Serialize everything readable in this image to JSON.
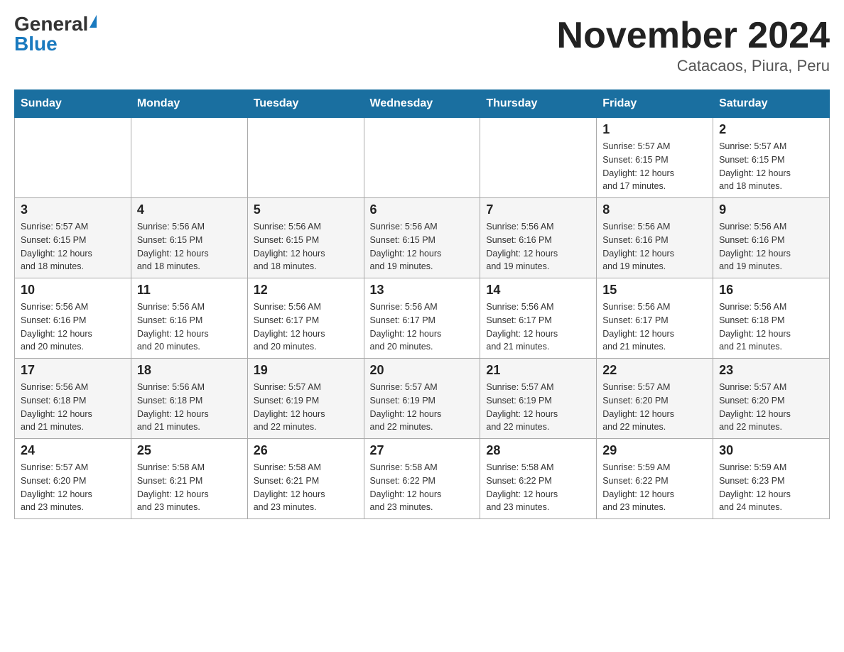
{
  "header": {
    "logo_general": "General",
    "logo_blue": "Blue",
    "title": "November 2024",
    "subtitle": "Catacaos, Piura, Peru"
  },
  "weekdays": [
    "Sunday",
    "Monday",
    "Tuesday",
    "Wednesday",
    "Thursday",
    "Friday",
    "Saturday"
  ],
  "weeks": [
    [
      {
        "day": "",
        "info": ""
      },
      {
        "day": "",
        "info": ""
      },
      {
        "day": "",
        "info": ""
      },
      {
        "day": "",
        "info": ""
      },
      {
        "day": "",
        "info": ""
      },
      {
        "day": "1",
        "info": "Sunrise: 5:57 AM\nSunset: 6:15 PM\nDaylight: 12 hours\nand 17 minutes."
      },
      {
        "day": "2",
        "info": "Sunrise: 5:57 AM\nSunset: 6:15 PM\nDaylight: 12 hours\nand 18 minutes."
      }
    ],
    [
      {
        "day": "3",
        "info": "Sunrise: 5:57 AM\nSunset: 6:15 PM\nDaylight: 12 hours\nand 18 minutes."
      },
      {
        "day": "4",
        "info": "Sunrise: 5:56 AM\nSunset: 6:15 PM\nDaylight: 12 hours\nand 18 minutes."
      },
      {
        "day": "5",
        "info": "Sunrise: 5:56 AM\nSunset: 6:15 PM\nDaylight: 12 hours\nand 18 minutes."
      },
      {
        "day": "6",
        "info": "Sunrise: 5:56 AM\nSunset: 6:15 PM\nDaylight: 12 hours\nand 19 minutes."
      },
      {
        "day": "7",
        "info": "Sunrise: 5:56 AM\nSunset: 6:16 PM\nDaylight: 12 hours\nand 19 minutes."
      },
      {
        "day": "8",
        "info": "Sunrise: 5:56 AM\nSunset: 6:16 PM\nDaylight: 12 hours\nand 19 minutes."
      },
      {
        "day": "9",
        "info": "Sunrise: 5:56 AM\nSunset: 6:16 PM\nDaylight: 12 hours\nand 19 minutes."
      }
    ],
    [
      {
        "day": "10",
        "info": "Sunrise: 5:56 AM\nSunset: 6:16 PM\nDaylight: 12 hours\nand 20 minutes."
      },
      {
        "day": "11",
        "info": "Sunrise: 5:56 AM\nSunset: 6:16 PM\nDaylight: 12 hours\nand 20 minutes."
      },
      {
        "day": "12",
        "info": "Sunrise: 5:56 AM\nSunset: 6:17 PM\nDaylight: 12 hours\nand 20 minutes."
      },
      {
        "day": "13",
        "info": "Sunrise: 5:56 AM\nSunset: 6:17 PM\nDaylight: 12 hours\nand 20 minutes."
      },
      {
        "day": "14",
        "info": "Sunrise: 5:56 AM\nSunset: 6:17 PM\nDaylight: 12 hours\nand 21 minutes."
      },
      {
        "day": "15",
        "info": "Sunrise: 5:56 AM\nSunset: 6:17 PM\nDaylight: 12 hours\nand 21 minutes."
      },
      {
        "day": "16",
        "info": "Sunrise: 5:56 AM\nSunset: 6:18 PM\nDaylight: 12 hours\nand 21 minutes."
      }
    ],
    [
      {
        "day": "17",
        "info": "Sunrise: 5:56 AM\nSunset: 6:18 PM\nDaylight: 12 hours\nand 21 minutes."
      },
      {
        "day": "18",
        "info": "Sunrise: 5:56 AM\nSunset: 6:18 PM\nDaylight: 12 hours\nand 21 minutes."
      },
      {
        "day": "19",
        "info": "Sunrise: 5:57 AM\nSunset: 6:19 PM\nDaylight: 12 hours\nand 22 minutes."
      },
      {
        "day": "20",
        "info": "Sunrise: 5:57 AM\nSunset: 6:19 PM\nDaylight: 12 hours\nand 22 minutes."
      },
      {
        "day": "21",
        "info": "Sunrise: 5:57 AM\nSunset: 6:19 PM\nDaylight: 12 hours\nand 22 minutes."
      },
      {
        "day": "22",
        "info": "Sunrise: 5:57 AM\nSunset: 6:20 PM\nDaylight: 12 hours\nand 22 minutes."
      },
      {
        "day": "23",
        "info": "Sunrise: 5:57 AM\nSunset: 6:20 PM\nDaylight: 12 hours\nand 22 minutes."
      }
    ],
    [
      {
        "day": "24",
        "info": "Sunrise: 5:57 AM\nSunset: 6:20 PM\nDaylight: 12 hours\nand 23 minutes."
      },
      {
        "day": "25",
        "info": "Sunrise: 5:58 AM\nSunset: 6:21 PM\nDaylight: 12 hours\nand 23 minutes."
      },
      {
        "day": "26",
        "info": "Sunrise: 5:58 AM\nSunset: 6:21 PM\nDaylight: 12 hours\nand 23 minutes."
      },
      {
        "day": "27",
        "info": "Sunrise: 5:58 AM\nSunset: 6:22 PM\nDaylight: 12 hours\nand 23 minutes."
      },
      {
        "day": "28",
        "info": "Sunrise: 5:58 AM\nSunset: 6:22 PM\nDaylight: 12 hours\nand 23 minutes."
      },
      {
        "day": "29",
        "info": "Sunrise: 5:59 AM\nSunset: 6:22 PM\nDaylight: 12 hours\nand 23 minutes."
      },
      {
        "day": "30",
        "info": "Sunrise: 5:59 AM\nSunset: 6:23 PM\nDaylight: 12 hours\nand 24 minutes."
      }
    ]
  ]
}
